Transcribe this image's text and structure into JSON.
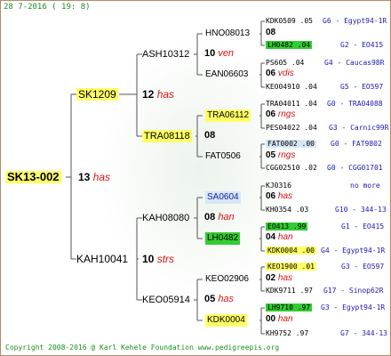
{
  "header": {
    "date": "28 7-2016 ( 19: 8)"
  },
  "footer": {
    "copyright": "Copyright 2008-2016 @ Karl Kehele Foundation www.pedigreepis.org"
  },
  "gen1": {
    "name": "SK13-002"
  },
  "gen1_note": {
    "num": "13",
    "suffix": "has"
  },
  "gen2": [
    {
      "name": "SK1209"
    },
    {
      "name": "KAH10041"
    }
  ],
  "gen2_notes": [
    {
      "num": "12",
      "suffix": "has"
    },
    {
      "num": "10",
      "suffix": "strs"
    }
  ],
  "gen3": [
    {
      "name": "ASH10312"
    },
    {
      "name": "TRA08118"
    },
    {
      "name": "KAH08080"
    },
    {
      "name": "KEO05914"
    }
  ],
  "gen3_notes": [
    {
      "num": "10",
      "suffix": "ven"
    },
    {
      "num": "08",
      "suffix": ""
    },
    {
      "num": "08",
      "suffix": "han"
    },
    {
      "num": "05",
      "suffix": "has"
    }
  ],
  "gen4": [
    {
      "name": "HNO08013"
    },
    {
      "name": "EAN06603"
    },
    {
      "name": "TRA06112"
    },
    {
      "name": "FAT0506"
    },
    {
      "name": "SA0604"
    },
    {
      "name": "LH0482"
    },
    {
      "name": "KEO02906"
    },
    {
      "name": "KDK0004"
    }
  ],
  "gen4_notes": [
    {
      "num": "08",
      "suffix": ""
    },
    {
      "num": "06",
      "suffix": "vdis"
    },
    {
      "num": "06",
      "suffix": "rngs"
    },
    {
      "num": "05",
      "suffix": "rngs"
    },
    {
      "num": "06",
      "suffix": "has"
    },
    {
      "num": "04",
      "suffix": "han"
    },
    {
      "num": "02",
      "suffix": "has"
    },
    {
      "num": "00",
      "suffix": "han"
    }
  ],
  "gen5": [
    {
      "name": "KDK0509 .05",
      "info": "G6 - Egypt94-1R"
    },
    {
      "name": "LH0482 .04",
      "info": "G2 - EO415"
    },
    {
      "name": "PS605 .04",
      "info": "G4 - Caucas98R"
    },
    {
      "name": "KEO04910 .04",
      "info": "G5 - EO597"
    },
    {
      "name": "TRA04011 .04",
      "info": "G0 - TRA04088"
    },
    {
      "name": "PES04022 .04",
      "info": "G3 - Carnic99R"
    },
    {
      "name": "FAT0002 .00",
      "info": "G0 - FAT9802"
    },
    {
      "name": "CGG02510 .02",
      "info": "G0 - CGG01701"
    },
    {
      "name": "KJ0316",
      "info": "no more"
    },
    {
      "name": "KH0354 .03",
      "info": "G10 - 344-13"
    },
    {
      "name": "EO413 .99",
      "info": "G1 - EO415"
    },
    {
      "name": "KDK0004 .00",
      "info": "G4 - Egypt94-1R"
    },
    {
      "name": "KEO1900 .01",
      "info": "G3 - EO597"
    },
    {
      "name": "KDK9711 .97",
      "info": "G17 - Sinop62R"
    },
    {
      "name": "LH9710 .97",
      "info": "G3 - Egypt94-1R"
    },
    {
      "name": "KH9752 .97",
      "info": "G7 - 344-13"
    }
  ]
}
